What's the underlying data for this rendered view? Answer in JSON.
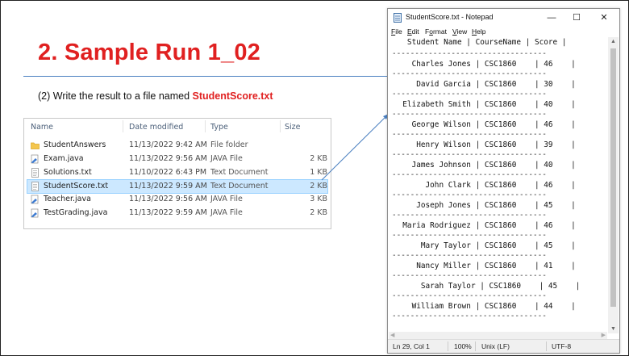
{
  "slide": {
    "title": "2. Sample Run 1_02",
    "subtitle_prefix": "(2) Write the result to a file named ",
    "subtitle_highlight": "StudentScore.txt"
  },
  "explorer": {
    "columns": {
      "name": "Name",
      "date": "Date modified",
      "type": "Type",
      "size": "Size"
    },
    "files": [
      {
        "name": "StudentAnswers",
        "date": "11/13/2022 9:42 AM",
        "type": "File folder",
        "size": "",
        "icon": "folder-icon"
      },
      {
        "name": "Exam.java",
        "date": "11/13/2022 9:56 AM",
        "type": "JAVA File",
        "size": "2 KB",
        "icon": "java-file-icon"
      },
      {
        "name": "Solutions.txt",
        "date": "11/10/2022 6:43 PM",
        "type": "Text Document",
        "size": "1 KB",
        "icon": "text-file-icon"
      },
      {
        "name": "StudentScore.txt",
        "date": "11/13/2022 9:59 AM",
        "type": "Text Document",
        "size": "2 KB",
        "icon": "text-file-icon",
        "selected": true
      },
      {
        "name": "Teacher.java",
        "date": "11/13/2022 9:56 AM",
        "type": "JAVA File",
        "size": "3 KB",
        "icon": "java-file-icon"
      },
      {
        "name": "TestGrading.java",
        "date": "11/13/2022 9:59 AM",
        "type": "JAVA File",
        "size": "2 KB",
        "icon": "java-file-icon"
      }
    ]
  },
  "notepad": {
    "title": "StudentScore.txt - Notepad",
    "window_controls": {
      "minimize": "—",
      "maximize": "☐",
      "close": "✕"
    },
    "menu": [
      {
        "key": "F",
        "rest": "ile"
      },
      {
        "key": "E",
        "rest": "dit"
      },
      {
        "key": "o",
        "pre": "F",
        "rest": "rmat"
      },
      {
        "key": "V",
        "rest": "iew"
      },
      {
        "key": "H",
        "rest": "elp"
      }
    ],
    "header_line": "   Student Name | CourseName | Score |",
    "dash_line": "----------------------------------",
    "rows": [
      "    Charles Jones | CSC1860    | 46    |",
      "     David Garcia | CSC1860    | 30    |",
      "  Elizabeth Smith | CSC1860    | 40    |",
      "    George Wilson | CSC1860    | 46    |",
      "     Henry Wilson | CSC1860    | 39    |",
      "    James Johnson | CSC1860    | 40    |",
      "       John Clark | CSC1860    | 46    |",
      "     Joseph Jones | CSC1860    | 45    |",
      "  Maria Rodriguez | CSC1860    | 46    |",
      "      Mary Taylor | CSC1860    | 45    |",
      "     Nancy Miller | CSC1860    | 41    |",
      "      Sarah Taylor | CSC1860    | 45    |",
      "    William Brown | CSC1860    | 44    |"
    ],
    "status": {
      "position": "Ln 29, Col 1",
      "zoom": "100%",
      "line_ending": "Unix (LF)",
      "encoding": "UTF-8"
    }
  }
}
